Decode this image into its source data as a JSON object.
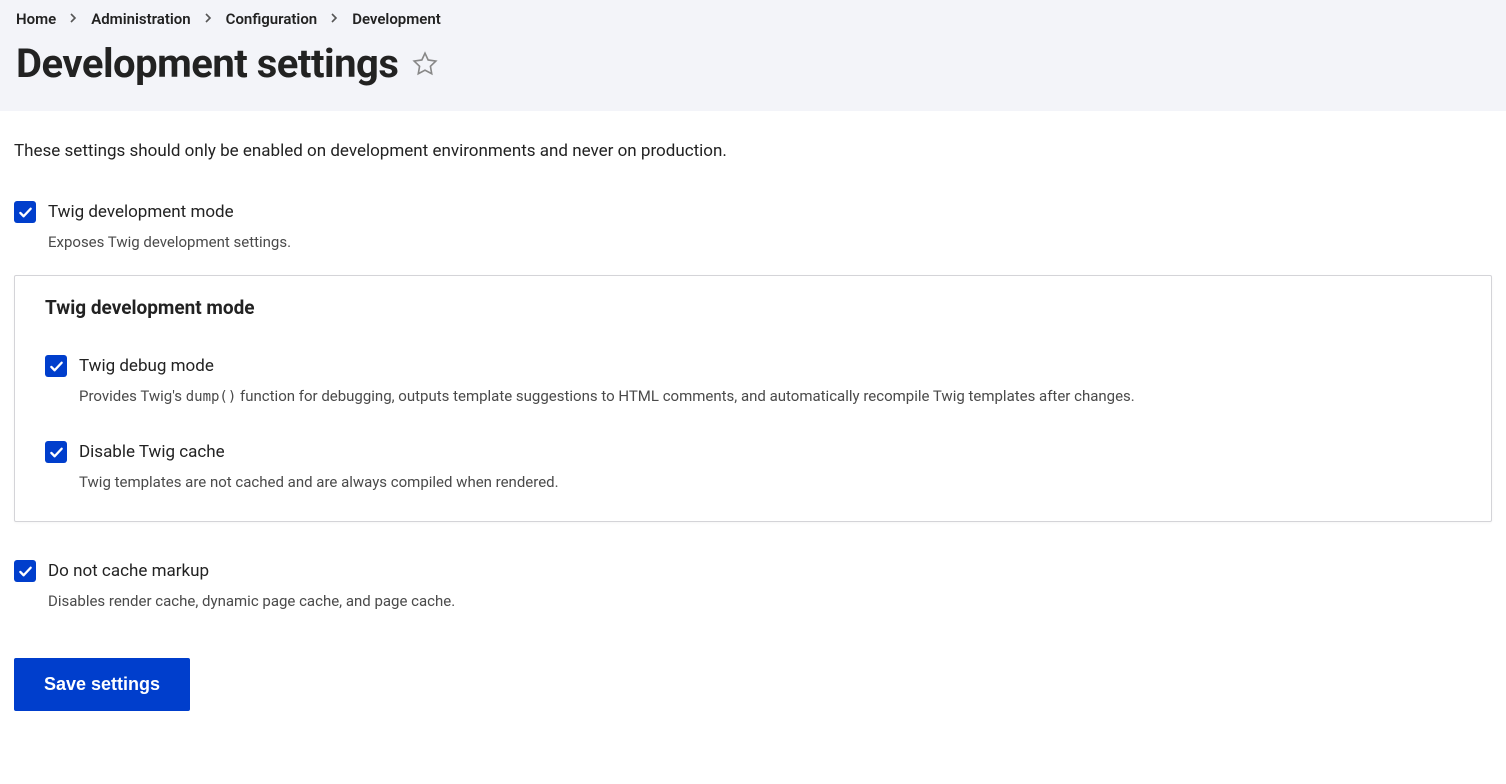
{
  "breadcrumb": {
    "items": [
      {
        "label": "Home"
      },
      {
        "label": "Administration"
      },
      {
        "label": "Configuration"
      },
      {
        "label": "Development"
      }
    ]
  },
  "page": {
    "title": "Development settings",
    "intro": "These settings should only be enabled on development environments and never on production."
  },
  "form": {
    "twig_dev_mode": {
      "label": "Twig development mode",
      "description": "Exposes Twig development settings.",
      "checked": true
    },
    "fieldset": {
      "legend": "Twig development mode",
      "twig_debug": {
        "label": "Twig debug mode",
        "desc_prefix": "Provides Twig's ",
        "desc_code": "dump()",
        "desc_suffix": " function for debugging, outputs template suggestions to HTML comments, and automatically recompile Twig templates after changes.",
        "checked": true
      },
      "disable_twig_cache": {
        "label": "Disable Twig cache",
        "description": "Twig templates are not cached and are always compiled when rendered.",
        "checked": true
      }
    },
    "no_cache_markup": {
      "label": "Do not cache markup",
      "description": "Disables render cache, dynamic page cache, and page cache.",
      "checked": true
    },
    "save_label": "Save settings"
  }
}
